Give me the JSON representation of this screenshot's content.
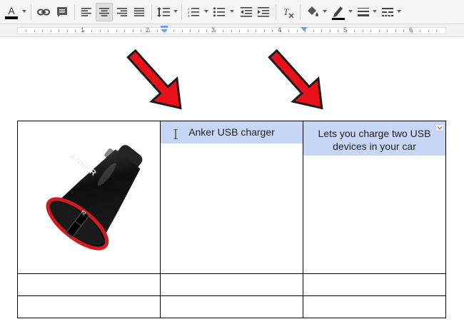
{
  "colors": {
    "toolbar_bg": "#f5f5f5",
    "selection": "#c5d7f5",
    "arrow": "#e8111a",
    "text": "#222222"
  },
  "toolbar": {
    "buttons": [
      {
        "name": "text-color-icon",
        "glyph": "A"
      },
      {
        "name": "link-icon"
      },
      {
        "name": "comment-icon"
      },
      {
        "name": "align-left-icon"
      },
      {
        "name": "align-center-icon",
        "active": true
      },
      {
        "name": "align-right-icon"
      },
      {
        "name": "align-justify-icon"
      },
      {
        "name": "line-spacing-icon"
      },
      {
        "name": "numbered-list-icon"
      },
      {
        "name": "bulleted-list-icon"
      },
      {
        "name": "decrease-indent-icon"
      },
      {
        "name": "increase-indent-icon"
      },
      {
        "name": "clear-formatting-icon"
      },
      {
        "name": "cell-background-color-icon"
      },
      {
        "name": "border-color-icon"
      },
      {
        "name": "border-width-icon"
      },
      {
        "name": "border-dash-icon"
      }
    ]
  },
  "ruler": {
    "numbers": [
      "1",
      "2",
      "3",
      "4",
      "5",
      "6"
    ]
  },
  "table": {
    "rows": [
      [
        "",
        "Anker USB charger",
        "Lets you charge two USB devices in your car"
      ],
      [
        "",
        "",
        ""
      ],
      [
        "",
        "",
        ""
      ]
    ],
    "image": {
      "brand_text": "ANKER",
      "port_label": "IQ"
    }
  }
}
